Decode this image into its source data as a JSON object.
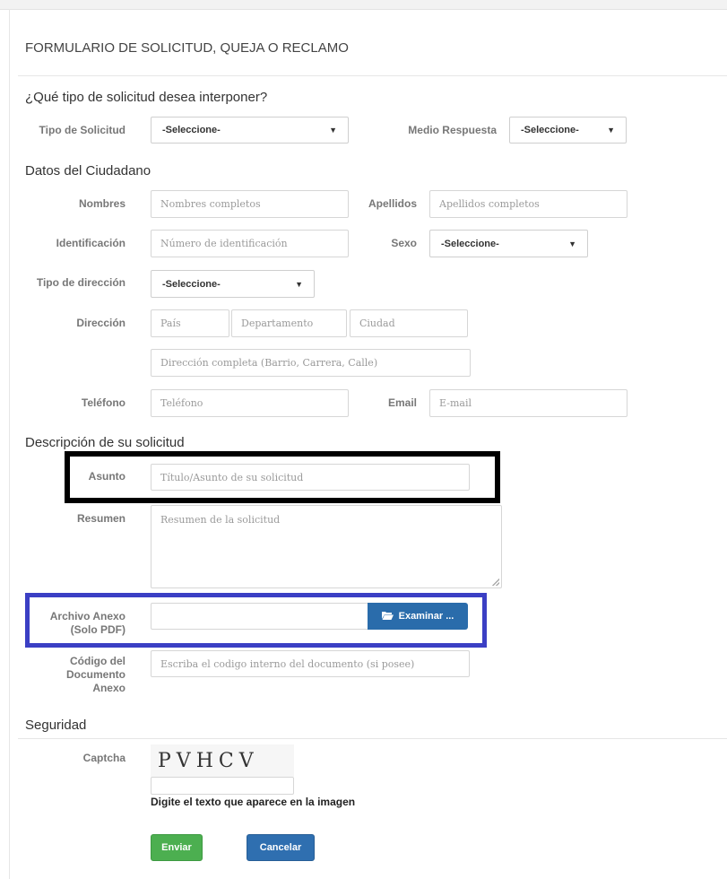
{
  "form": {
    "title": "FORMULARIO DE SOLICITUD, QUEJA O RECLAMO",
    "request_type_question": "¿Qué tipo de solicitud desea interponer?",
    "tipo_solicitud": {
      "label": "Tipo de Solicitud",
      "value": "-Seleccione-"
    },
    "medio_respuesta": {
      "label": "Medio Respuesta",
      "value": "-Seleccione-"
    }
  },
  "citizen": {
    "section_title": "Datos del Ciudadano",
    "nombres": {
      "label": "Nombres",
      "placeholder": "Nombres completos"
    },
    "apellidos": {
      "label": "Apellidos",
      "placeholder": "Apellidos completos"
    },
    "identificacion": {
      "label": "Identificación",
      "placeholder": "Número de identificación"
    },
    "sexo": {
      "label": "Sexo",
      "value": "-Seleccione-"
    },
    "tipo_direccion": {
      "label": "Tipo de dirección",
      "value": "-Seleccione-"
    },
    "direccion": {
      "label": "Dirección",
      "pais_placeholder": "País",
      "departamento_placeholder": "Departamento",
      "ciudad_placeholder": "Ciudad",
      "completa_placeholder": "Dirección completa (Barrio, Carrera, Calle)"
    },
    "telefono": {
      "label": "Teléfono",
      "placeholder": "Teléfono"
    },
    "email": {
      "label": "Email",
      "placeholder": "E-mail"
    }
  },
  "description": {
    "section_title": "Descripción de su solicitud",
    "asunto": {
      "label": "Asunto",
      "placeholder": "Título/Asunto de su solicitud"
    },
    "resumen": {
      "label": "Resumen",
      "placeholder": "Resumen de la solicitud"
    },
    "archivo": {
      "label_line1": "Archivo Anexo",
      "label_line2": "(Solo PDF)",
      "button_label": "Examinar ..."
    },
    "codigo": {
      "label_line1": "Código del",
      "label_line2": "Documento",
      "label_line3": "Anexo",
      "placeholder": "Escriba el codigo interno del documento (si posee)"
    }
  },
  "security": {
    "section_title": "Seguridad",
    "captcha_label": "Captcha",
    "captcha_text": "PVHCV",
    "captcha_hint": "Digite el texto que aparece en la imagen"
  },
  "actions": {
    "submit_label": "Enviar",
    "cancel_label": "Cancelar"
  },
  "colors": {
    "highlight_black": "#000000",
    "highlight_blue": "#3b3fc4",
    "browse_button": "#2a6cab",
    "submit_button": "#4caf50",
    "cancel_button": "#2f6fb0"
  },
  "icons": {
    "folder": "folder-open-icon",
    "dropdown": "caret-down-icon"
  }
}
